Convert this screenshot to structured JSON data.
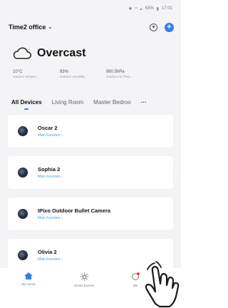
{
  "status_bar": {
    "battery": "63%",
    "time": "17:01",
    "icons": [
      "bluetooth-icon",
      "wifi-icon",
      "signal-icon",
      "battery-icon"
    ]
  },
  "header": {
    "home_name": "Time2 office",
    "home_chevron": "⌄",
    "camera_icon": "camera-scan-icon",
    "add_icon": "+"
  },
  "weather": {
    "condition": "Overcast",
    "icon": "cloud-icon",
    "stats": [
      {
        "value": "10°C",
        "label": "Outdoor Temper..."
      },
      {
        "value": "93%",
        "label": "Outdoor Humidity"
      },
      {
        "value": "980.5hPa",
        "label": "Outdoor Air Pres..."
      }
    ]
  },
  "tabs": {
    "items": [
      "All Devices",
      "Living Room",
      "Master Bedroo"
    ],
    "more": "···",
    "active_index": 0
  },
  "devices": [
    {
      "name": "Oscar 2",
      "subtitle": "Main Function ›"
    },
    {
      "name": "Sophia 2",
      "subtitle": "Main Function ›"
    },
    {
      "name": "IPixo Outdoor Bullet Camera",
      "subtitle": "Main Function ›"
    },
    {
      "name": "Olivia 2",
      "subtitle": "Main Function ›"
    }
  ],
  "bottom_nav": [
    {
      "label": "My Home",
      "icon": "home-icon",
      "active": true
    },
    {
      "label": "Smart Scenes",
      "icon": "sun-icon",
      "active": false
    },
    {
      "label": "Me",
      "icon": "profile-icon",
      "active": false
    }
  ],
  "colors": {
    "accent": "#2f7ff0",
    "subtitle": "#4a9be8",
    "badge": "#e0453a",
    "background": "#f4f4f6"
  }
}
